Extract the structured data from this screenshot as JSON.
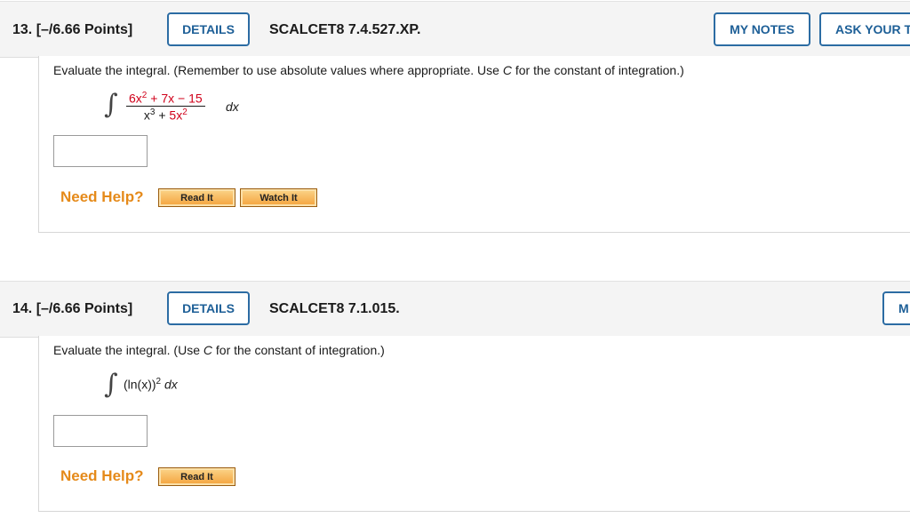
{
  "questions": [
    {
      "number": "13.",
      "points": "[–/6.66 Points]",
      "details_label": "DETAILS",
      "reference": "SCALCET8 7.4.527.XP.",
      "my_notes_label": "MY NOTES",
      "ask_teacher_label": "ASK YOUR T",
      "prompt_before": "Evaluate the integral. (Remember to use absolute values where appropriate. Use ",
      "prompt_var": "C",
      "prompt_after": " for the constant of integration.)",
      "numerator_6x": "6x",
      "numerator_exp": "2",
      "numerator_rest_a": " + 7x ",
      "numerator_minus": "−",
      "numerator_rest_b": " 15",
      "denominator_x": "x",
      "denominator_exp1": "3",
      "denominator_plus": " + ",
      "denominator_5x": "5x",
      "denominator_exp2": "2",
      "dx": "dx",
      "answer_value": "",
      "need_help": "Need Help?",
      "read_it": "Read It",
      "watch_it": "Watch It"
    },
    {
      "number": "14.",
      "points": "[–/6.66 Points]",
      "details_label": "DETAILS",
      "reference": "SCALCET8 7.1.015.",
      "my_notes_label": "M",
      "prompt_before": "Evaluate the integral. (Use ",
      "prompt_var": "C",
      "prompt_after": " for the constant of integration.)",
      "integrand": "(ln(x))",
      "integrand_exp": "2",
      "dx": "dx",
      "answer_value": "",
      "need_help": "Need Help?",
      "read_it": "Read It"
    }
  ],
  "integral_symbol": "∫",
  "colors": {
    "accent_blue": "#1d5f97",
    "help_orange": "#e58a1a",
    "term_red": "#d0021b"
  }
}
